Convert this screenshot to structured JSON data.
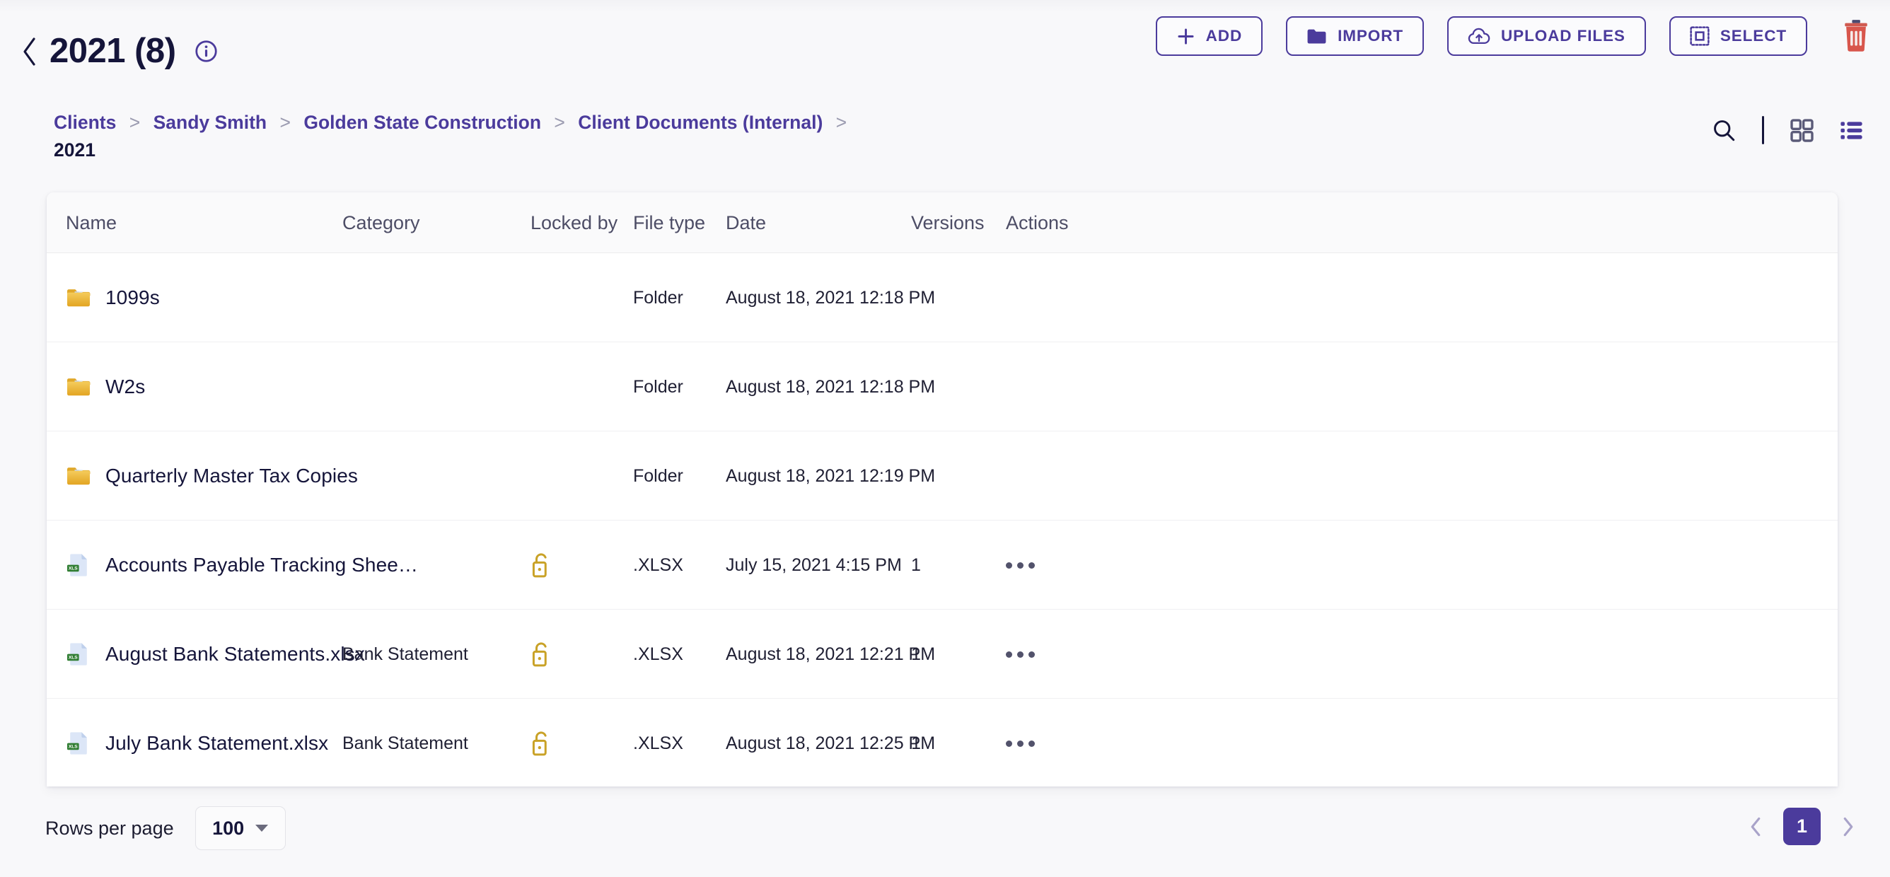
{
  "header": {
    "back_icon": "chevron-left-icon",
    "title": "2021 (8)",
    "info_icon": "info-circle-icon",
    "buttons": [
      {
        "label": "ADD",
        "icon": "plus-icon"
      },
      {
        "label": "IMPORT",
        "icon": "folder-icon"
      },
      {
        "label": "UPLOAD FILES",
        "icon": "cloud-upload-icon"
      },
      {
        "label": "SELECT",
        "icon": "selection-box-icon"
      }
    ],
    "delete_icon": "trash-icon",
    "accent_color": "#4b3b9c"
  },
  "breadcrumb": {
    "separator": ">",
    "links": [
      "Clients",
      "Sandy Smith",
      "Golden State Construction",
      "Client Documents (Internal)"
    ],
    "current": "2021"
  },
  "view_tools": {
    "search_icon": "search-icon",
    "grid_view_icon": "grid-view-icon",
    "list_view_icon": "list-view-icon",
    "active_view": "list"
  },
  "table": {
    "columns": [
      "Name",
      "Category",
      "Locked by",
      "File type",
      "Date",
      "Versions",
      "Actions"
    ],
    "rows": [
      {
        "icon": "folder-icon",
        "name": "1099s",
        "category": "",
        "locked": false,
        "file_type": "Folder",
        "date": "August 18, 2021 12:18 PM",
        "versions": "",
        "actions": false
      },
      {
        "icon": "folder-icon",
        "name": "W2s",
        "category": "",
        "locked": false,
        "file_type": "Folder",
        "date": "August 18, 2021 12:18 PM",
        "versions": "",
        "actions": false
      },
      {
        "icon": "folder-icon",
        "name": "Quarterly Master Tax Copies",
        "category": "",
        "locked": false,
        "file_type": "Folder",
        "date": "August 18, 2021 12:19 PM",
        "versions": "",
        "actions": false
      },
      {
        "icon": "xls-file-icon",
        "name": "Accounts Payable Tracking Shee…",
        "category": "",
        "locked": true,
        "file_type": ".XLSX",
        "date": "July 15, 2021 4:15 PM",
        "versions": "1",
        "actions": true
      },
      {
        "icon": "xls-file-icon",
        "name": "August Bank Statements.xlsx",
        "category": "Bank Statement",
        "locked": true,
        "file_type": ".XLSX",
        "date": "August 18, 2021 12:21 PM",
        "versions": "1",
        "actions": true
      },
      {
        "icon": "xls-file-icon",
        "name": "July Bank Statement.xlsx",
        "category": "Bank Statement",
        "locked": true,
        "file_type": ".XLSX",
        "date": "August 18, 2021 12:25 PM",
        "versions": "1",
        "actions": true
      }
    ],
    "lock_icon": "unlocked-padlock-icon",
    "lock_color": "#c9a227",
    "actions_icon": "more-horizontal-icon"
  },
  "footer": {
    "rows_per_page_label": "Rows per page",
    "rows_per_page_value": "100",
    "dropdown_icon": "caret-down-icon",
    "prev_icon": "chevron-left-icon",
    "next_icon": "chevron-right-icon",
    "current_page": "1"
  }
}
